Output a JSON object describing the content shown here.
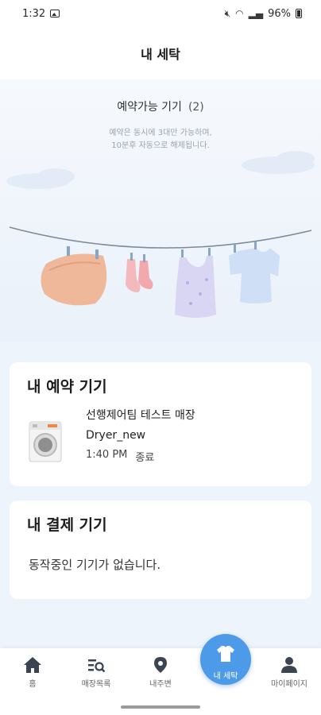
{
  "status_bar": {
    "time": "1:32",
    "battery": "96%"
  },
  "header": {
    "title": "내 세탁"
  },
  "hero": {
    "available_label": "예약가능 기기",
    "available_count": "(2)",
    "notice_line1": "예약은 동시에 3대만 가능하며,",
    "notice_line2": "10분후 자동으로 해제됩니다."
  },
  "reservation": {
    "title": "내 예약 기기",
    "items": [
      {
        "store": "선행제어팀 테스트 매장",
        "device": "Dryer_new",
        "time": "1:40 PM",
        "status": "종료"
      }
    ]
  },
  "payment": {
    "title": "내 결제 기기",
    "empty_message": "동작중인 기기가 없습니다."
  },
  "bottom_nav": {
    "items": [
      {
        "label": "홈",
        "icon": "home-icon"
      },
      {
        "label": "매장목록",
        "icon": "store-list-icon"
      },
      {
        "label": "내주변",
        "icon": "location-pin-icon"
      },
      {
        "label": "내 세탁",
        "icon": "shirt-icon"
      },
      {
        "label": "마이페이지",
        "icon": "person-icon"
      }
    ],
    "active_index": 3
  },
  "colors": {
    "accent": "#4d9be8",
    "background": "#eef4fb"
  }
}
